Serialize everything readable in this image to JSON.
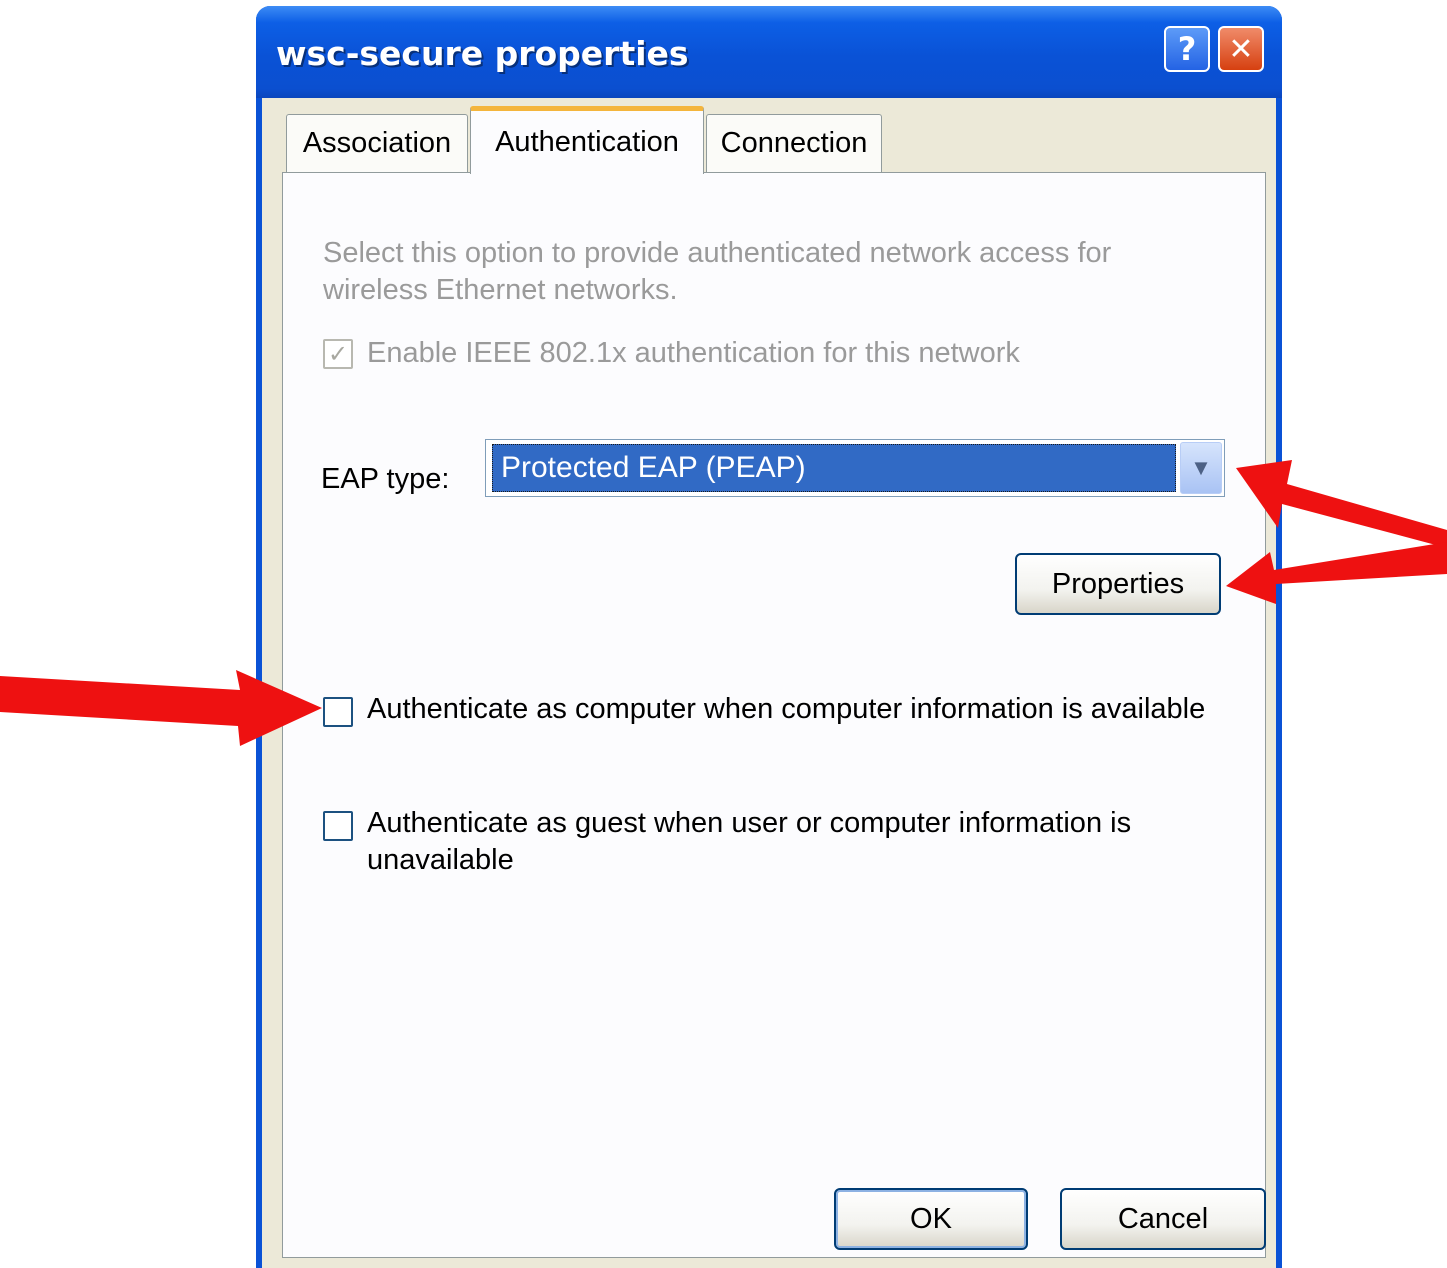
{
  "window": {
    "title": "wsc-secure properties",
    "help_glyph": "?",
    "close_glyph": "✕"
  },
  "tabs": [
    {
      "label": "Association",
      "active": false
    },
    {
      "label": "Authentication",
      "active": true
    },
    {
      "label": "Connection",
      "active": false
    }
  ],
  "authentication": {
    "description": "Select this option to provide authenticated network access for wireless Ethernet networks.",
    "enable_8021x": {
      "label": "Enable IEEE 802.1x authentication for this network",
      "checked": true,
      "enabled": false
    },
    "eap_type_label": "EAP type:",
    "eap_type_value": "Protected EAP (PEAP)",
    "properties_button": "Properties",
    "auth_as_computer": {
      "label": "Authenticate as computer when computer information is available",
      "checked": false
    },
    "auth_as_guest": {
      "label": "Authenticate as guest when user or computer information is unavailable",
      "checked": false
    }
  },
  "footer": {
    "ok_label": "OK",
    "cancel_label": "Cancel"
  },
  "annotation_color": "#ee1111"
}
